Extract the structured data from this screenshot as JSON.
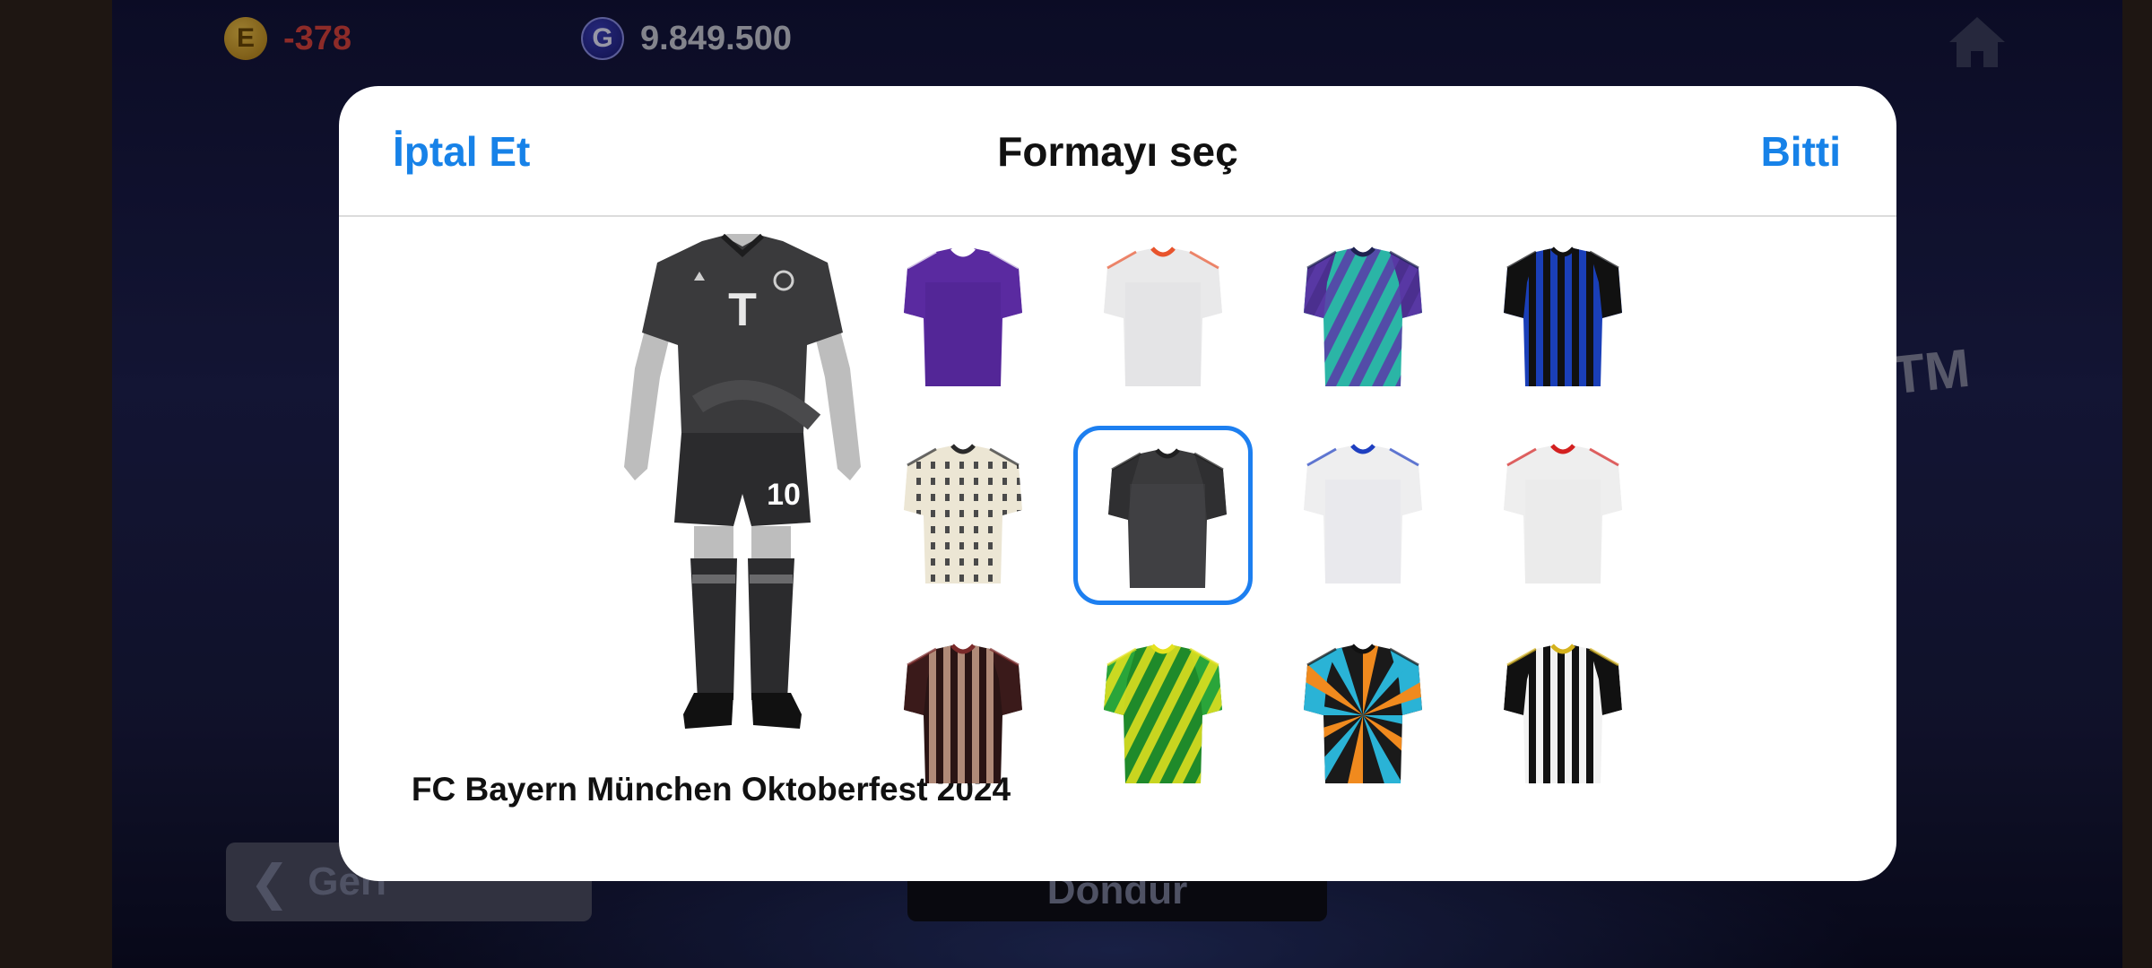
{
  "hud": {
    "ecoin_value": "-378",
    "gp_value": "9.849.500",
    "ecoin_symbol": "E",
    "gp_symbol": "G",
    "ecoin_color": "#d9433e",
    "gp_color": "#c9cbd8"
  },
  "dialog": {
    "cancel_label": "İptal Et",
    "title": "Formayı seç",
    "done_label": "Bitti",
    "accent_color": "#1782e8",
    "preview_number": "10",
    "selected_kit_name": "FC Bayern München Oktoberfest 2024",
    "selected_index": 5
  },
  "kits": [
    {
      "icon": "jersey-purple",
      "body": "#5a2aa0",
      "sleeve": "#5a2aa0",
      "collar": "#ffffff",
      "stripe": "#3f1c7a",
      "pattern": "none"
    },
    {
      "icon": "jersey-white-orange",
      "body": "#e9e9ea",
      "sleeve": "#e9e9ea",
      "collar": "#e8542d",
      "stripe": "#d8d8da",
      "pattern": "none"
    },
    {
      "icon": "jersey-teal-purple",
      "body": "#2bb5a6",
      "sleeve": "#4b2f8f",
      "collar": "#1f2250",
      "stripe": "#5b3aa8",
      "pattern": "diag"
    },
    {
      "icon": "jersey-blue-black-stripes",
      "body": "#1a3fb8",
      "sleeve": "#111111",
      "collar": "#111111",
      "stripe": "#111111",
      "pattern": "vstripes"
    },
    {
      "icon": "jersey-cream-pattern",
      "body": "#ece6d4",
      "sleeve": "#ece6d4",
      "collar": "#2a2a2a",
      "stripe": "#4a4a4a",
      "pattern": "dots"
    },
    {
      "icon": "jersey-bayern-oktoberfest",
      "body": "#3a3a3c",
      "sleeve": "#2f2f31",
      "collar": "#1f1f20",
      "stripe": "#555557",
      "pattern": "none"
    },
    {
      "icon": "jersey-white-blue",
      "body": "#eeeeef",
      "sleeve": "#eeeeef",
      "collar": "#1e3fc0",
      "stripe": "#dcdce6",
      "pattern": "none"
    },
    {
      "icon": "jersey-white-red",
      "body": "#eeeeee",
      "sleeve": "#eeeeee",
      "collar": "#d32020",
      "stripe": "#e2e2e2",
      "pattern": "none"
    },
    {
      "icon": "jersey-maroon-stripes",
      "body": "#2a1414",
      "sleeve": "#3a1a1a",
      "collar": "#7a2a2a",
      "stripe": "#b08a78",
      "pattern": "vstripes"
    },
    {
      "icon": "jersey-green-yellow",
      "body": "#1f8a2a",
      "sleeve": "#2aa53a",
      "collar": "#e6e21e",
      "stripe": "#e6e21e",
      "pattern": "diag"
    },
    {
      "icon": "jersey-black-cyan-orange",
      "body": "#1a1a1a",
      "sleeve": "#2ab3d6",
      "collar": "#111111",
      "stripe": "#f08a1e",
      "pattern": "burst"
    },
    {
      "icon": "jersey-black-white-stripes",
      "body": "#f2f2f2",
      "sleeve": "#111111",
      "collar": "#d4b21e",
      "stripe": "#111111",
      "pattern": "vstripes"
    }
  ],
  "background": {
    "back_label": "Geri",
    "center_label": "Dondur",
    "side_label": "TM"
  }
}
